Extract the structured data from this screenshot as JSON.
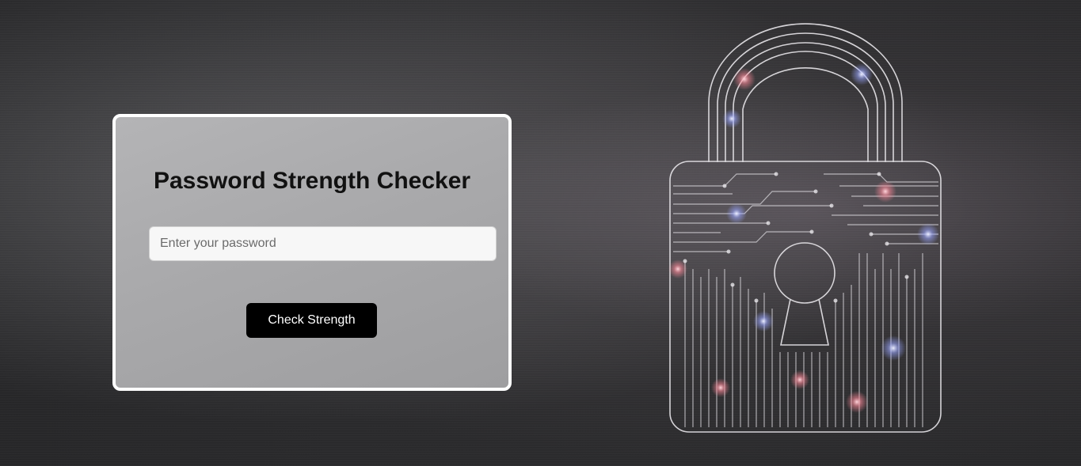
{
  "card": {
    "title": "Password Strength Checker"
  },
  "password_input": {
    "placeholder": "Enter your password",
    "value": ""
  },
  "check_button": {
    "label": "Check Strength"
  },
  "background": {
    "image": "circuit-padlock-icon"
  },
  "colors": {
    "button_background": "#000000",
    "button_text": "#ffffff",
    "card_border": "#ffffff"
  }
}
